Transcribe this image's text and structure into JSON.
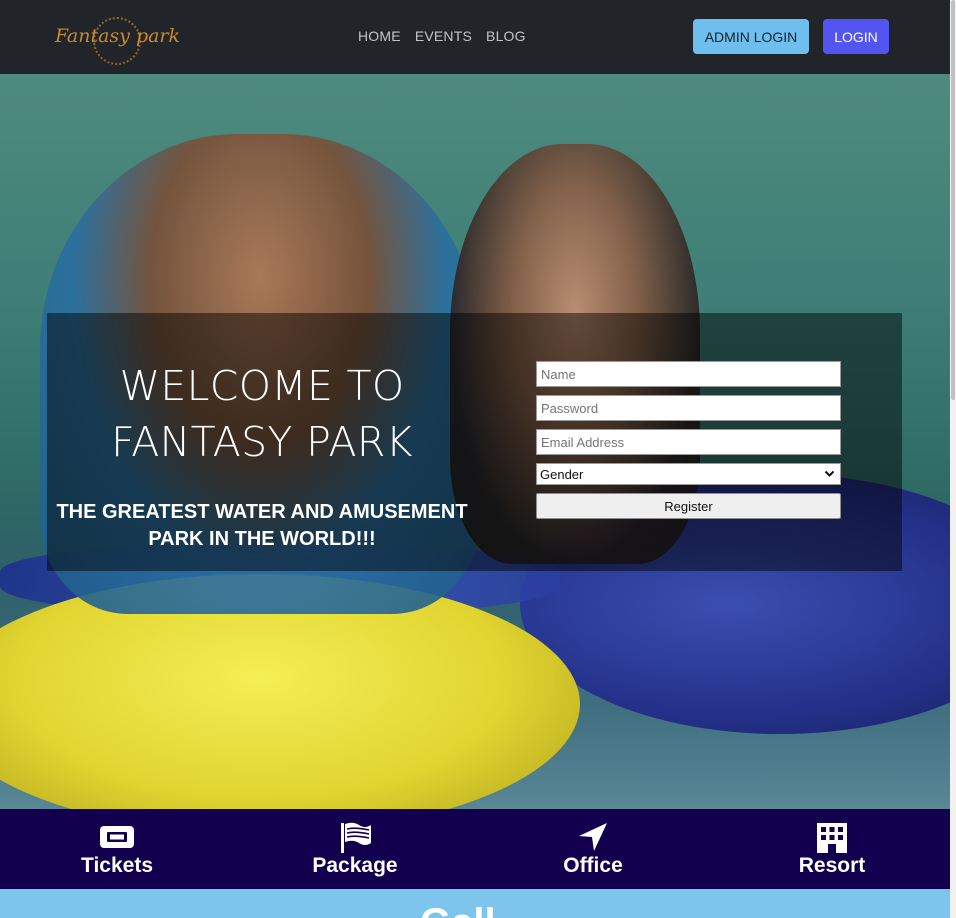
{
  "navbar": {
    "logo_text": "Fantasy park",
    "links": [
      "HOME",
      "EVENTS",
      "BLOG"
    ],
    "admin_login_label": "ADMIN LOGIN",
    "login_label": "LOGIN"
  },
  "hero": {
    "title_line1": "WELCOME TO",
    "title_line2": "FANTASY PARK",
    "subtitle_line1": "THE GREATEST WATER AND AMUSEMENT",
    "subtitle_line2": "PARK IN THE WORLD!!!"
  },
  "form": {
    "name_placeholder": "Name",
    "password_placeholder": "Password",
    "email_placeholder": "Email Address",
    "gender_selected": "Gender",
    "register_label": "Register"
  },
  "features": [
    {
      "label": "Tickets",
      "icon": "ticket-icon"
    },
    {
      "label": "Package",
      "icon": "flag-icon"
    },
    {
      "label": "Office",
      "icon": "location-arrow-icon"
    },
    {
      "label": "Resort",
      "icon": "building-icon"
    }
  ],
  "gallery": {
    "title": "Gall"
  },
  "colors": {
    "navbar_bg": "#212529",
    "admin_button": "#6fbfee",
    "login_button": "#5355f2",
    "features_bg": "#12004f",
    "gallery_bg": "#7ec5ee"
  }
}
